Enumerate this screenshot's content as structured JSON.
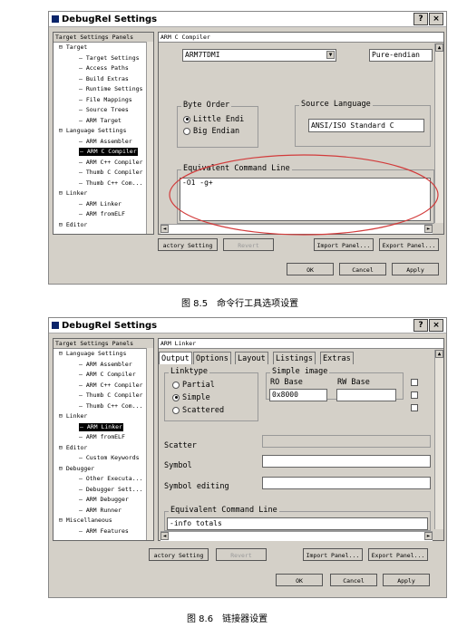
{
  "fig1": {
    "window_title": "DebugRel Settings",
    "title_btn_help": "?",
    "title_btn_close": "×",
    "tree_header": "Target Settings Panels",
    "tree": [
      "Target",
      "Target Settings",
      "Access Paths",
      "Build Extras",
      "Runtime Settings",
      "File Mappings",
      "Source Trees",
      "ARM Target",
      "Language Settings",
      "ARM Assembler",
      "ARM C Compiler",
      "ARM C++ Compiler",
      "Thumb C Compiler",
      "Thumb C++ Com...",
      "Linker",
      "ARM Linker",
      "ARM fromELF",
      "Editor"
    ],
    "panel_header": "ARM C Compiler",
    "arch_value": "ARM7TDMI",
    "endian_value": "Pure-endian",
    "byte_order_label": "Byte Order",
    "little_endian": "Little Endi",
    "big_endian": "Big Endian",
    "source_language_label": "Source Language",
    "source_language_value": "ANSI/ISO Standard C",
    "cmd_label": "Equivalent Command Line",
    "cmd_value": "-O1 -g+",
    "factory_btn": "actory Setting",
    "revert_btn": "Revert",
    "import_btn": "Import Panel...",
    "export_btn": "Export Panel...",
    "ok_btn": "OK",
    "cancel_btn": "Cancel",
    "apply_btn": "Apply",
    "caption": "图 8.5　命令行工具选项设置"
  },
  "fig2": {
    "window_title": "DebugRel Settings",
    "title_btn_help": "?",
    "title_btn_close": "×",
    "tree_header": "Target Settings Panels",
    "tree": [
      "Language Settings",
      "ARM Assembler",
      "ARM C Compiler",
      "ARM C++ Compiler",
      "Thumb C Compiler",
      "Thumb C++ Com...",
      "Linker",
      "ARM Linker",
      "ARM fromELF",
      "Editor",
      "Custom Keywords",
      "Debugger",
      "Other Executa...",
      "Debugger Sett...",
      "ARM Debugger",
      "ARM Runner",
      "Miscellaneous",
      "ARM Features"
    ],
    "panel_header": "ARM Linker",
    "tabs": [
      "Output",
      "Options",
      "Layout",
      "Listings",
      "Extras"
    ],
    "linktype_label": "Linktype",
    "partial": "Partial",
    "simple": "Simple",
    "scattered": "Scattered",
    "simple_image_label": "Simple image",
    "ro_base_label": "RO Base",
    "rw_base_label": "RW Base",
    "ro_base_value": "0x8000",
    "scatter_label": "Scatter",
    "symbol_label": "Symbol",
    "symbol_editing_label": "Symbol editing",
    "cmd_label": "Equivalent Command Line",
    "cmd_value": "-info totals",
    "factory_btn": "actory Setting",
    "revert_btn": "Revert",
    "import_btn": "Import Panel...",
    "export_btn": "Export Panel...",
    "ok_btn": "OK",
    "cancel_btn": "Cancel",
    "apply_btn": "Apply",
    "caption": "图 8.6　链接器设置"
  },
  "colors": {
    "annotation_circle": "#d23b3b",
    "selection": "#000000"
  }
}
